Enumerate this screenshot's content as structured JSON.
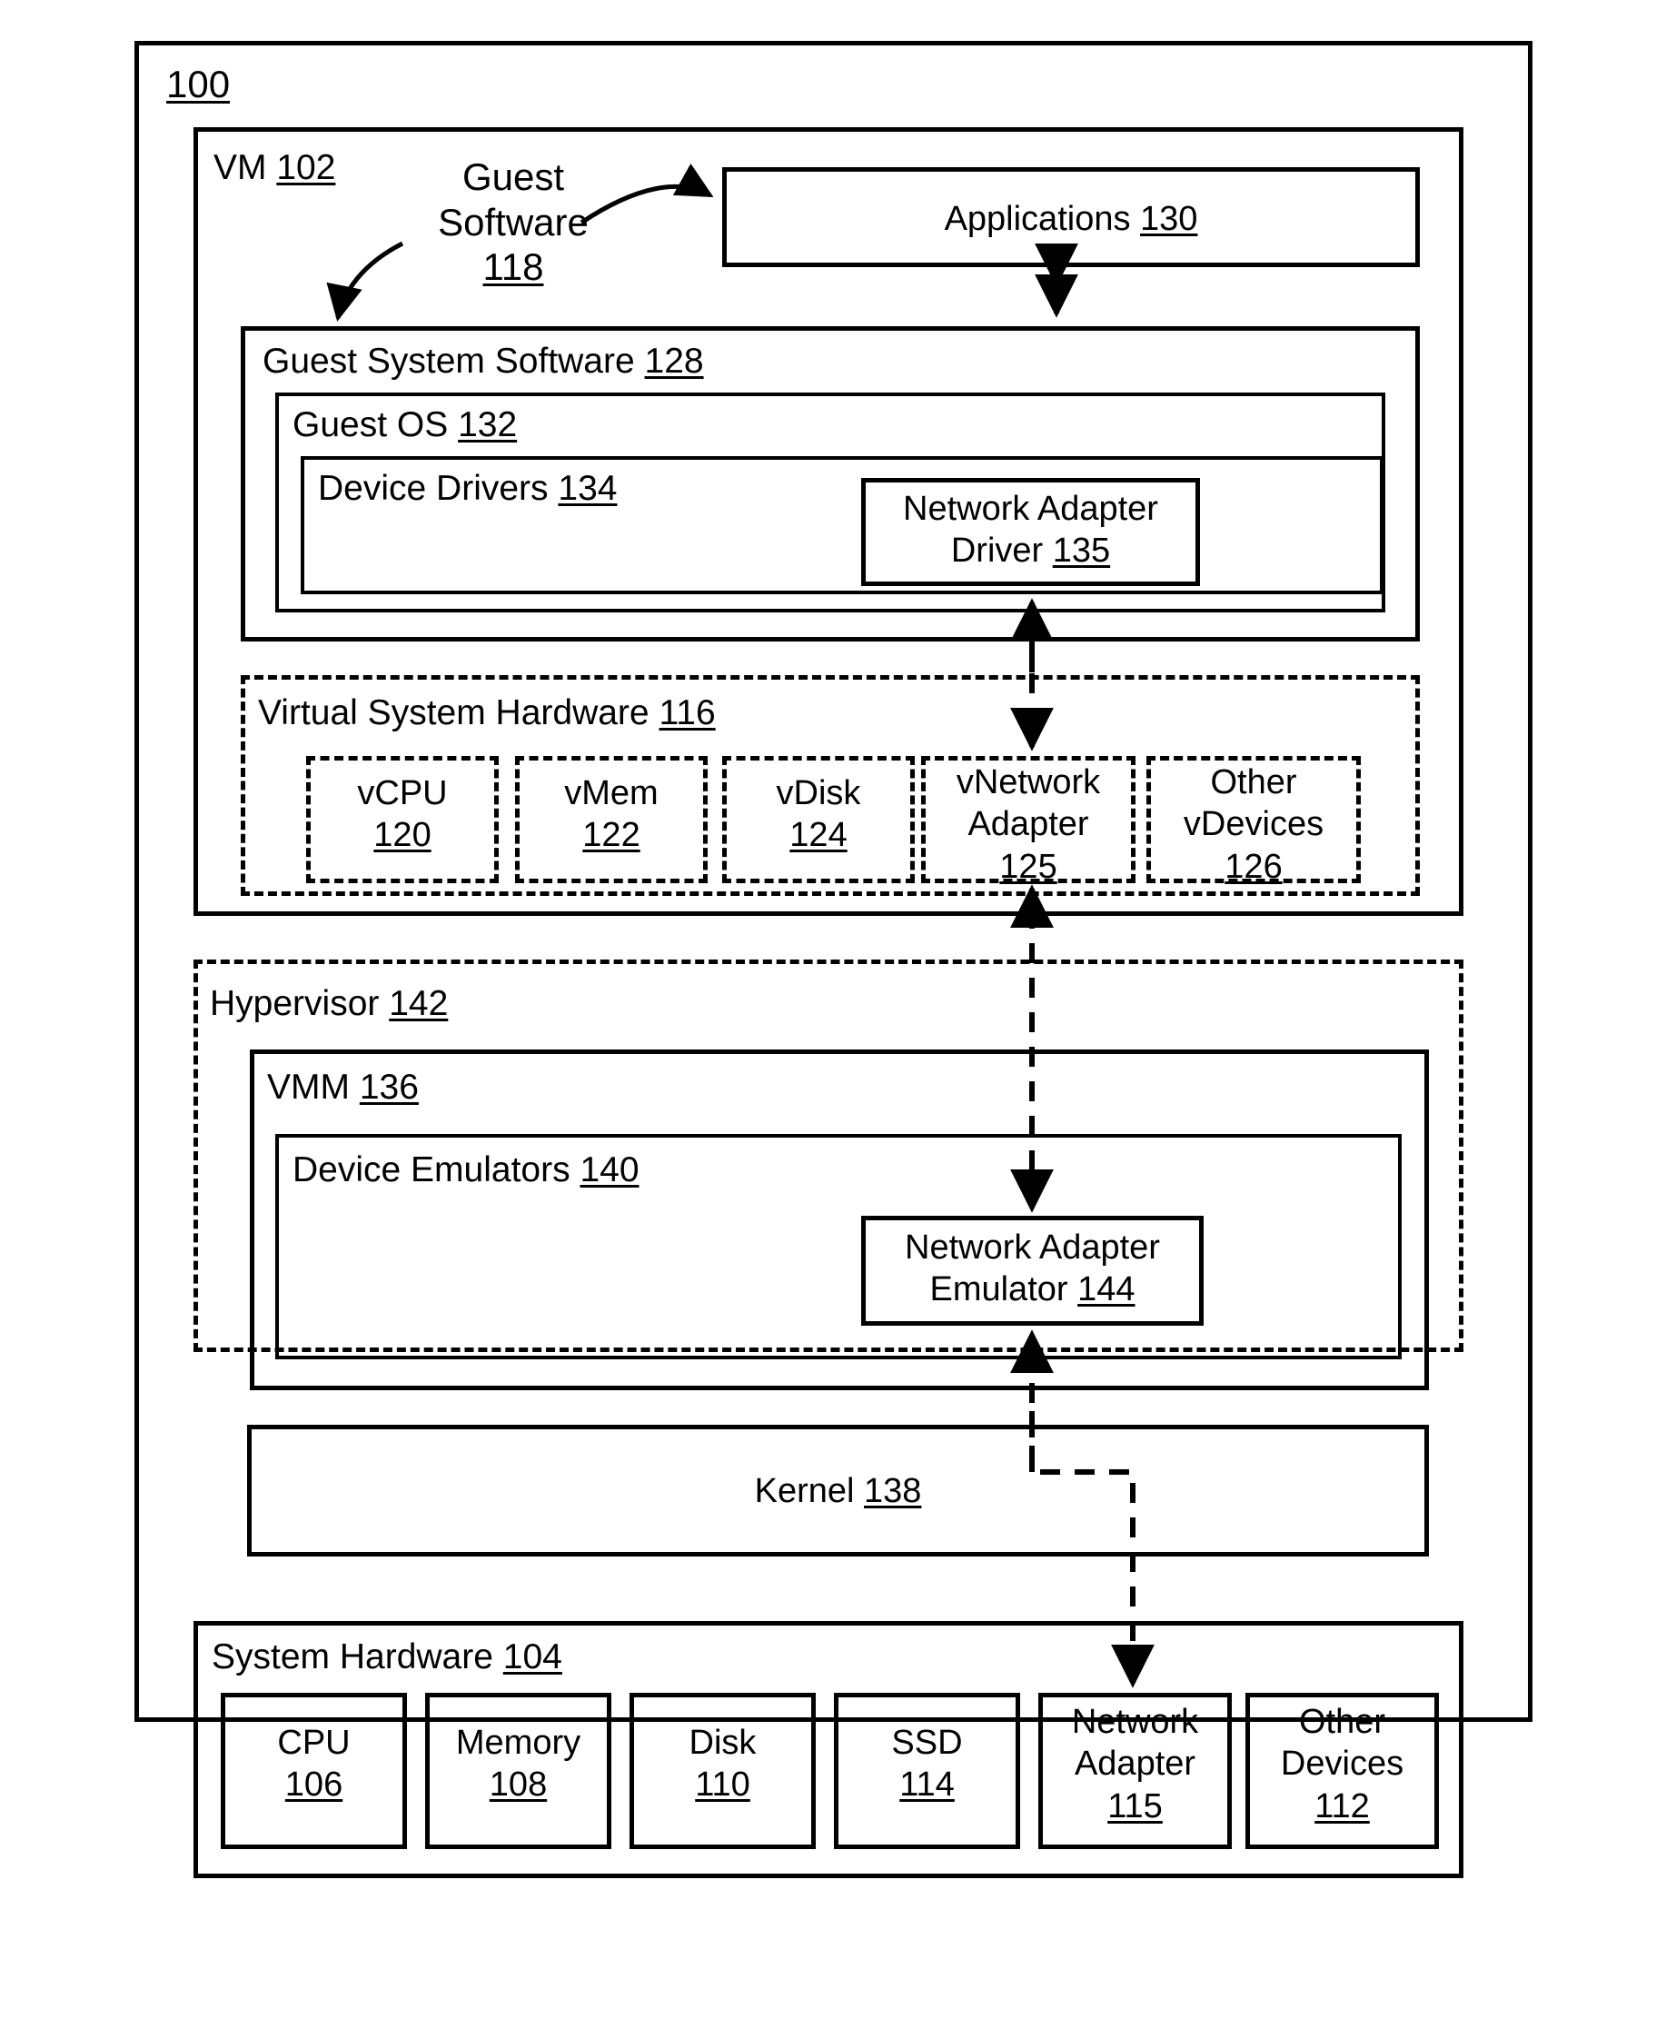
{
  "figure": {
    "number": "100"
  },
  "vm": {
    "title": "VM",
    "ref": "102"
  },
  "callout": {
    "line1": "Guest",
    "line2": "Software",
    "ref": "118"
  },
  "applications": {
    "label": "Applications",
    "ref": "130"
  },
  "guest_system_software": {
    "label": "Guest System Software",
    "ref": "128"
  },
  "guest_os": {
    "label": "Guest OS",
    "ref": "132"
  },
  "device_drivers": {
    "label": "Device Drivers",
    "ref": "134"
  },
  "network_adapter_driver": {
    "line1": "Network Adapter",
    "line2": "Driver",
    "ref": "135"
  },
  "virtual_system_hardware": {
    "label": "Virtual System Hardware",
    "ref": "116",
    "devices": [
      {
        "name": "vCPU",
        "ref": "120",
        "lines": [
          "vCPU"
        ]
      },
      {
        "name": "vMem",
        "ref": "122",
        "lines": [
          "vMem"
        ]
      },
      {
        "name": "vDisk",
        "ref": "124",
        "lines": [
          "vDisk"
        ]
      },
      {
        "name": "vNetwork Adapter",
        "ref": "125",
        "lines": [
          "vNetwork",
          "Adapter"
        ]
      },
      {
        "name": "Other vDevices",
        "ref": "126",
        "lines": [
          "Other",
          "vDevices"
        ]
      }
    ]
  },
  "hypervisor": {
    "label": "Hypervisor",
    "ref": "142"
  },
  "vmm": {
    "label": "VMM",
    "ref": "136"
  },
  "device_emulators": {
    "label": "Device Emulators",
    "ref": "140"
  },
  "network_adapter_emulator": {
    "line1": "Network Adapter",
    "line2": "Emulator",
    "ref": "144"
  },
  "kernel": {
    "label": "Kernel",
    "ref": "138"
  },
  "system_hardware": {
    "label": "System Hardware",
    "ref": "104",
    "devices": [
      {
        "name": "CPU",
        "ref": "106",
        "lines": [
          "CPU"
        ]
      },
      {
        "name": "Memory",
        "ref": "108",
        "lines": [
          "Memory"
        ]
      },
      {
        "name": "Disk",
        "ref": "110",
        "lines": [
          "Disk"
        ]
      },
      {
        "name": "SSD",
        "ref": "114",
        "lines": [
          "SSD"
        ]
      },
      {
        "name": "Network Adapter",
        "ref": "115",
        "lines": [
          "Network",
          "Adapter"
        ]
      },
      {
        "name": "Other Devices",
        "ref": "112",
        "lines": [
          "Other",
          "Devices"
        ]
      }
    ]
  },
  "colors": {
    "ink": "#000000",
    "paper": "#ffffff"
  }
}
